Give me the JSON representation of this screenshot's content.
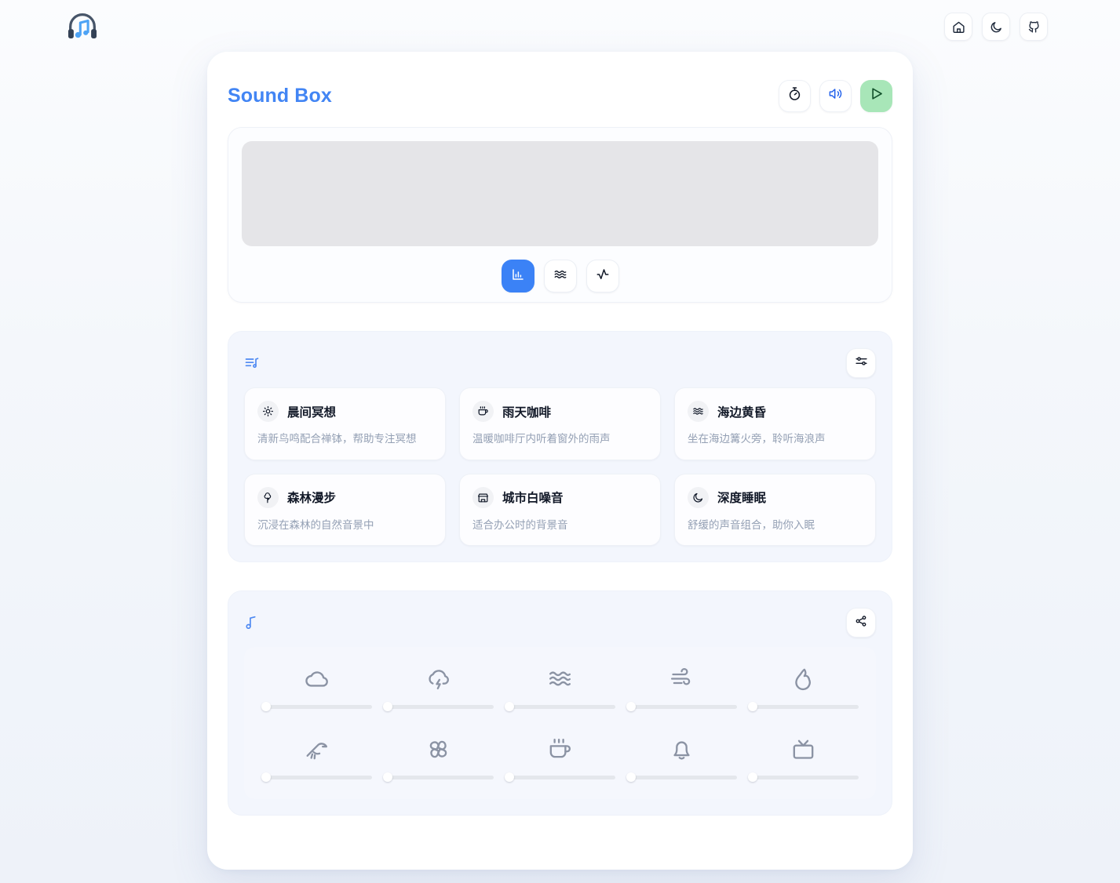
{
  "topbar": {
    "logo": "headphones-music-icon",
    "actions": [
      {
        "name": "home-button",
        "icon": "home-icon"
      },
      {
        "name": "theme-toggle-button",
        "icon": "moon-icon"
      },
      {
        "name": "github-link-button",
        "icon": "github-icon"
      }
    ]
  },
  "panel": {
    "title": "Sound Box",
    "header_actions": [
      {
        "name": "timer-button",
        "icon": "timer-icon"
      },
      {
        "name": "volume-button",
        "icon": "volume-icon"
      },
      {
        "name": "play-button",
        "icon": "play-icon"
      }
    ]
  },
  "visualizer": {
    "canvas_name": "visualizer-canvas",
    "modes": [
      {
        "name": "bar-mode",
        "icon": "bar-chart-icon",
        "active": true
      },
      {
        "name": "wave-mode",
        "icon": "waves-icon",
        "active": false
      },
      {
        "name": "pulse-mode",
        "icon": "activity-icon",
        "active": false
      }
    ]
  },
  "presets_section": {
    "header_icon": "list-music-icon",
    "settings_icon": "sliders-icon",
    "items": [
      {
        "icon": "sun-icon",
        "name": "晨间冥想",
        "desc": "清新鸟鸣配合禅钵，帮助专注冥想"
      },
      {
        "icon": "coffee-icon",
        "name": "雨天咖啡",
        "desc": "温暖咖啡厅内听着窗外的雨声"
      },
      {
        "icon": "waves-icon",
        "name": "海边黄昏",
        "desc": "坐在海边篝火旁，聆听海浪声"
      },
      {
        "icon": "tree-icon",
        "name": "森林漫步",
        "desc": "沉浸在森林的自然音景中"
      },
      {
        "icon": "store-icon",
        "name": "城市白噪音",
        "desc": "适合办公时的背景音"
      },
      {
        "icon": "moon-icon",
        "name": "深度睡眠",
        "desc": "舒缓的声音组合，助你入眠"
      }
    ]
  },
  "mixer_section": {
    "header_icon": "music-note-icon",
    "share_icon": "share-icon",
    "sounds": [
      {
        "icon": "cloud-icon",
        "name": "cloud-sound",
        "value": 0
      },
      {
        "icon": "cloud-lightning-icon",
        "name": "thunder-sound",
        "value": 0
      },
      {
        "icon": "waves-icon",
        "name": "waves-sound",
        "value": 0
      },
      {
        "icon": "wind-icon",
        "name": "wind-sound",
        "value": 0
      },
      {
        "icon": "flame-icon",
        "name": "fire-sound",
        "value": 0
      },
      {
        "icon": "bird-icon",
        "name": "bird-sound",
        "value": 0
      },
      {
        "icon": "fan-icon",
        "name": "fan-sound",
        "value": 0
      },
      {
        "icon": "coffee-icon",
        "name": "cafe-sound",
        "value": 0
      },
      {
        "icon": "bell-icon",
        "name": "bell-sound",
        "value": 0
      },
      {
        "icon": "tv-icon",
        "name": "tv-sound",
        "value": 0
      }
    ]
  },
  "colors": {
    "accent": "#4285f4",
    "accent_active": "#3b82f6",
    "play_bg": "#a8e6b8",
    "section_bg": "#f3f6fd",
    "muted_text": "#94a0b4"
  }
}
